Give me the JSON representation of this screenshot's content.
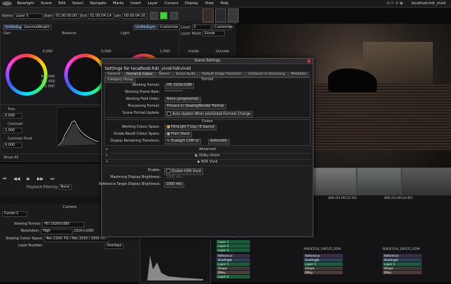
{
  "menubar": {
    "items": [
      "Baselight",
      "Scene",
      "Edit",
      "Select",
      "Navigate",
      "Marks",
      "Insert",
      "Layer",
      "Cursors",
      "Display",
      "View",
      "Help"
    ],
    "host": "localhost:hdr_vivid"
  },
  "toolbar": {
    "name_label": "Name",
    "name_value": "Layer 5",
    "start_label": "Start",
    "start_value": "01:00:00:00",
    "end_label": "End",
    "end_value": "01:00:04:14",
    "len_label": "Len",
    "len_value": "00:00:04:16"
  },
  "layer_panel": {
    "layer_label": "Layer",
    "layer_value": "5",
    "layer_mode_label": "Layer Mode",
    "layer_mode_value": "Grade",
    "customise": "Customise",
    "inside": "Inside",
    "outside": "Outside"
  },
  "grade_panel": {
    "tab1": "UnifiedLgm",
    "tab2": "GammaWeight",
    "balance": "Balance",
    "light": "Light",
    "unified": "UnifiedLgm",
    "customise": "Customise",
    "val1": "0.000",
    "val2": "1.000",
    "val3": "0.000",
    "val4": "1.000",
    "c_r": "R 1.000",
    "c_g": "G 1.000",
    "c_b": "B 1.000"
  },
  "curves_panel": {
    "row1": "Trim",
    "row2": "Contrast",
    "row3": "Contrast Pivot",
    "show_all": "Show All",
    "v1": "0.000",
    "v2": "1.000",
    "v3": "0.000"
  },
  "dialog": {
    "titlebar": "Scene Settings",
    "heading": "Settings for localhost:hdr_vivid:hdrvivid",
    "tabs": [
      "General",
      "Format & Colour",
      "Stereo",
      "Scene Audio",
      "Default Image Transform",
      "Container & Versioning",
      "Metadata",
      "Category Group"
    ],
    "active_tab": 1,
    "format_header": "Format",
    "working_format_label": "Working Format:",
    "working_format_value": "HD 1920x1080",
    "frame_rate_label": "Working Frame Rate:",
    "frame_rate_value": "",
    "field_order_label": "Working Field Order:",
    "field_order_value": "None (progressive)",
    "processing_format_label": "Processing Format:",
    "processing_format_value": "Process in Viewing/Render Format",
    "scene_format_update_label": "Scene Format Update:",
    "scene_format_update_value": "Auto Update When Job/Global Formats Change",
    "colour_header": "Colour",
    "working_colour_space_label": "Working Colour Space:",
    "working_colour_space_value": "FilmLight T-Log / E-Gamut",
    "grade_result_label": "Grade Result Colour Space:",
    "grade_result_value": "From Stack",
    "display_rendering_label": "Display Rendering Transform:",
    "display_rendering_value": "Truelight CAM v2",
    "display_rendering_mode": "Automatic",
    "advanced": "Advanced",
    "dolby_vision": "Dolby Vision",
    "hdr_vivid": "HDR Vivid",
    "enable_label": "Enable:",
    "enable_value": "Enable HDR Vivid",
    "mastering_label": "Mastering Display Brightness:",
    "mastering_value": "1000 nits",
    "reference_label": "Reference Target Display Brightness:",
    "reference_value": "1000 nits"
  },
  "playback": {
    "filter_label": "Playback Filtering",
    "filter_value": "None",
    "cursors_title": "Cursors",
    "cursor_value": "Cursor 1"
  },
  "viewport": {
    "viewing_format_label": "Viewing Format:",
    "viewing_format_value": "HD 1920x1080",
    "resolution_label": "Resolution:",
    "resolution_value": "High",
    "resolution_dims": "1920×1080",
    "colour_space_label": "Viewing Colour Space:",
    "colour_space_value": "Rec.2100: PQ / Rec.2020 / 1000 nits",
    "layer_number_label": "Layer Number:",
    "overlays": "Overlays"
  },
  "timeline": {
    "header1": "400 (01:00:22:10)",
    "header2": "400 (01:00:24:00)",
    "clip1": "A003C014_190125_R2IH",
    "clip2": "A003C014_190125_R2IH",
    "clip3": "A003C014_190125_R2IH",
    "tracks": [
      "Layer 1",
      "Layer 2",
      "Layer 3",
      "Reference",
      "HueAngle",
      "Layer 1",
      "Shape",
      "DKey",
      "Layer 4"
    ]
  }
}
